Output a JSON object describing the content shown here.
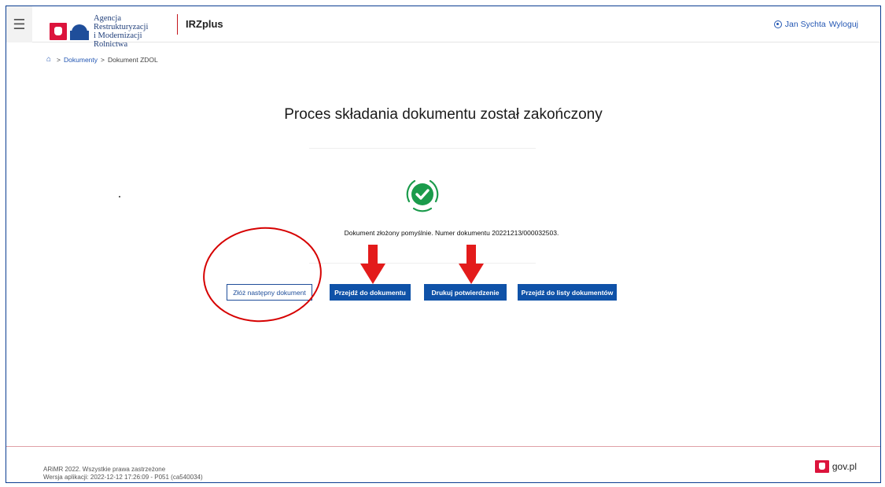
{
  "header": {
    "menu_icon": "hamburger-icon",
    "agency_line1": "Agencja Restrukturyzacji",
    "agency_line2": "i Modernizacji Rolnictwa",
    "app_name": "IRZplus",
    "user_name": "Jan Sychta",
    "logout_label": "Wyloguj"
  },
  "breadcrumb": {
    "home_icon": "home-icon",
    "items": [
      "Dokumenty",
      "Dokument ZDOL"
    ],
    "separator": ">"
  },
  "main": {
    "heading": "Proces składania dokumentu został zakończony",
    "success_icon": "check-circle-icon",
    "status_message": "Dokument złożony pomyślnie. Numer dokumentu 20221213/000032503.",
    "buttons": {
      "next_document": "Złóż następny dokument",
      "go_to_document": "Przejdź do dokumentu",
      "print_confirmation": "Drukuj potwierdzenie",
      "go_to_document_list": "Przejdź do listy dokumentów"
    }
  },
  "annotations": {
    "circle_color": "#d60000",
    "arrow_color": "#e31b1b"
  },
  "footer": {
    "copyright": "ARiMR 2022. Wszystkie prawa zastrzeżone",
    "version": "Wersja aplikacji: 2022-12-12 17:26:09 - P051 (ca540034)",
    "gov_label": "gov.pl"
  },
  "colors": {
    "primary": "#0f52a8",
    "link": "#2457b3",
    "success": "#1a9b4b"
  }
}
